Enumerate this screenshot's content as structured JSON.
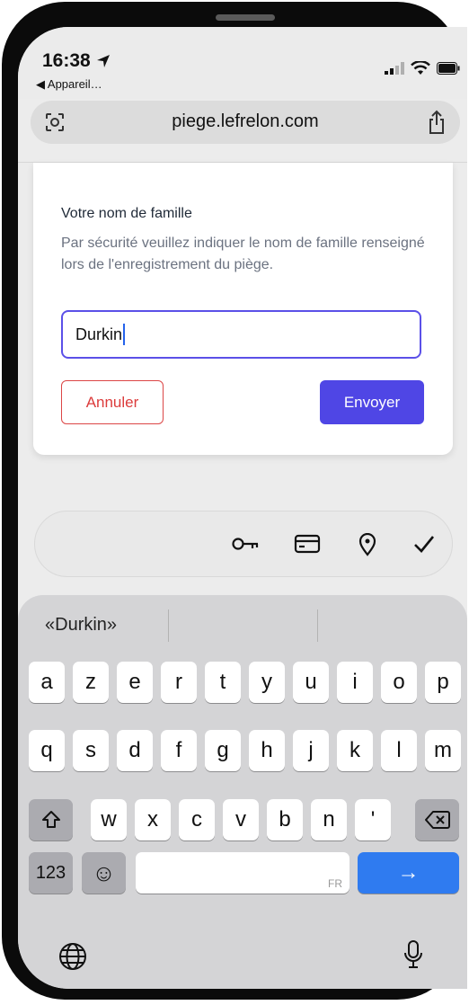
{
  "status": {
    "time": "16:38",
    "back_label": "◀ Appareil…"
  },
  "browser": {
    "url": "piege.lefrelon.com"
  },
  "dialog": {
    "title": "Votre nom de famille",
    "description": "Par sécurité veuillez indiquer le nom de famille renseigné lors de l'enregistrement du piège.",
    "input_value": "Durkin",
    "cancel_label": "Annuler",
    "submit_label": "Envoyer"
  },
  "keyboard": {
    "suggestion": "«Durkin»",
    "row1": [
      "a",
      "z",
      "e",
      "r",
      "t",
      "y",
      "u",
      "i",
      "o",
      "p"
    ],
    "row2": [
      "q",
      "s",
      "d",
      "f",
      "g",
      "h",
      "j",
      "k",
      "l",
      "m"
    ],
    "row3": [
      "w",
      "x",
      "c",
      "v",
      "b",
      "n",
      "'"
    ],
    "numbers_label": "123",
    "space_lang": "FR",
    "return_symbol": "→",
    "emoji_symbol": "☺"
  },
  "colors": {
    "accent": "#4f46e5",
    "cancel": "#dc3c3c",
    "return_key": "#2f7bf0"
  },
  "icons": [
    "location-arrow-icon",
    "signal-icon",
    "wifi-icon",
    "battery-icon",
    "reader-icon",
    "share-icon",
    "key-icon",
    "card-icon",
    "location-pin-icon",
    "checkmark-icon",
    "shift-icon",
    "backspace-icon",
    "emoji-icon",
    "globe-icon",
    "microphone-icon"
  ]
}
